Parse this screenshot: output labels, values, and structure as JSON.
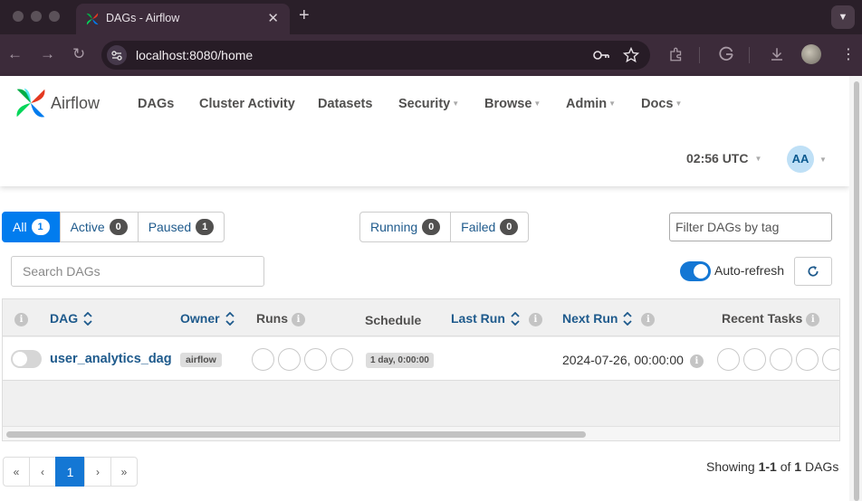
{
  "browser": {
    "tab_title": "DAGs - Airflow",
    "tab_close": "✕",
    "new_tab": "+",
    "url": "localhost:8080/home",
    "back": "←",
    "forward": "→",
    "reload": "↻"
  },
  "navbar": {
    "brand": "Airflow",
    "links": [
      "DAGs",
      "Cluster Activity",
      "Datasets",
      "Security",
      "Browse",
      "Admin",
      "Docs"
    ],
    "clock": "02:56 UTC",
    "avatar": "AA"
  },
  "filters": {
    "all": {
      "label": "All",
      "count": "1"
    },
    "active": {
      "label": "Active",
      "count": "0"
    },
    "paused": {
      "label": "Paused",
      "count": "1"
    },
    "running": {
      "label": "Running",
      "count": "0"
    },
    "failed": {
      "label": "Failed",
      "count": "0"
    },
    "tag_placeholder": "Filter DAGs by tag",
    "search_placeholder": "Search DAGs",
    "autorefresh_label": "Auto-refresh",
    "autorefresh_on": true
  },
  "table": {
    "headers": {
      "dag": "DAG",
      "owner": "Owner",
      "runs": "Runs",
      "schedule": "Schedule",
      "last_run": "Last Run",
      "next_run": "Next Run",
      "recent_tasks": "Recent Tasks"
    },
    "rows": [
      {
        "dag_id": "user_analytics_dag",
        "owner": "airflow",
        "schedule": "1 day, 0:00:00",
        "last_run": "",
        "next_run": "2024-07-26, 00:00:00",
        "paused": true
      }
    ]
  },
  "pagination": {
    "first": "«",
    "prev": "‹",
    "current": "1",
    "next": "›",
    "last": "»",
    "showing_prefix": "Showing",
    "showing_range": "1-1",
    "showing_of": "of",
    "showing_total": "1",
    "showing_suffix": "DAGs"
  },
  "colors": {
    "primary": "#017cee",
    "link": "#1e5a8c",
    "browser_frame": "#3c2b3a"
  }
}
